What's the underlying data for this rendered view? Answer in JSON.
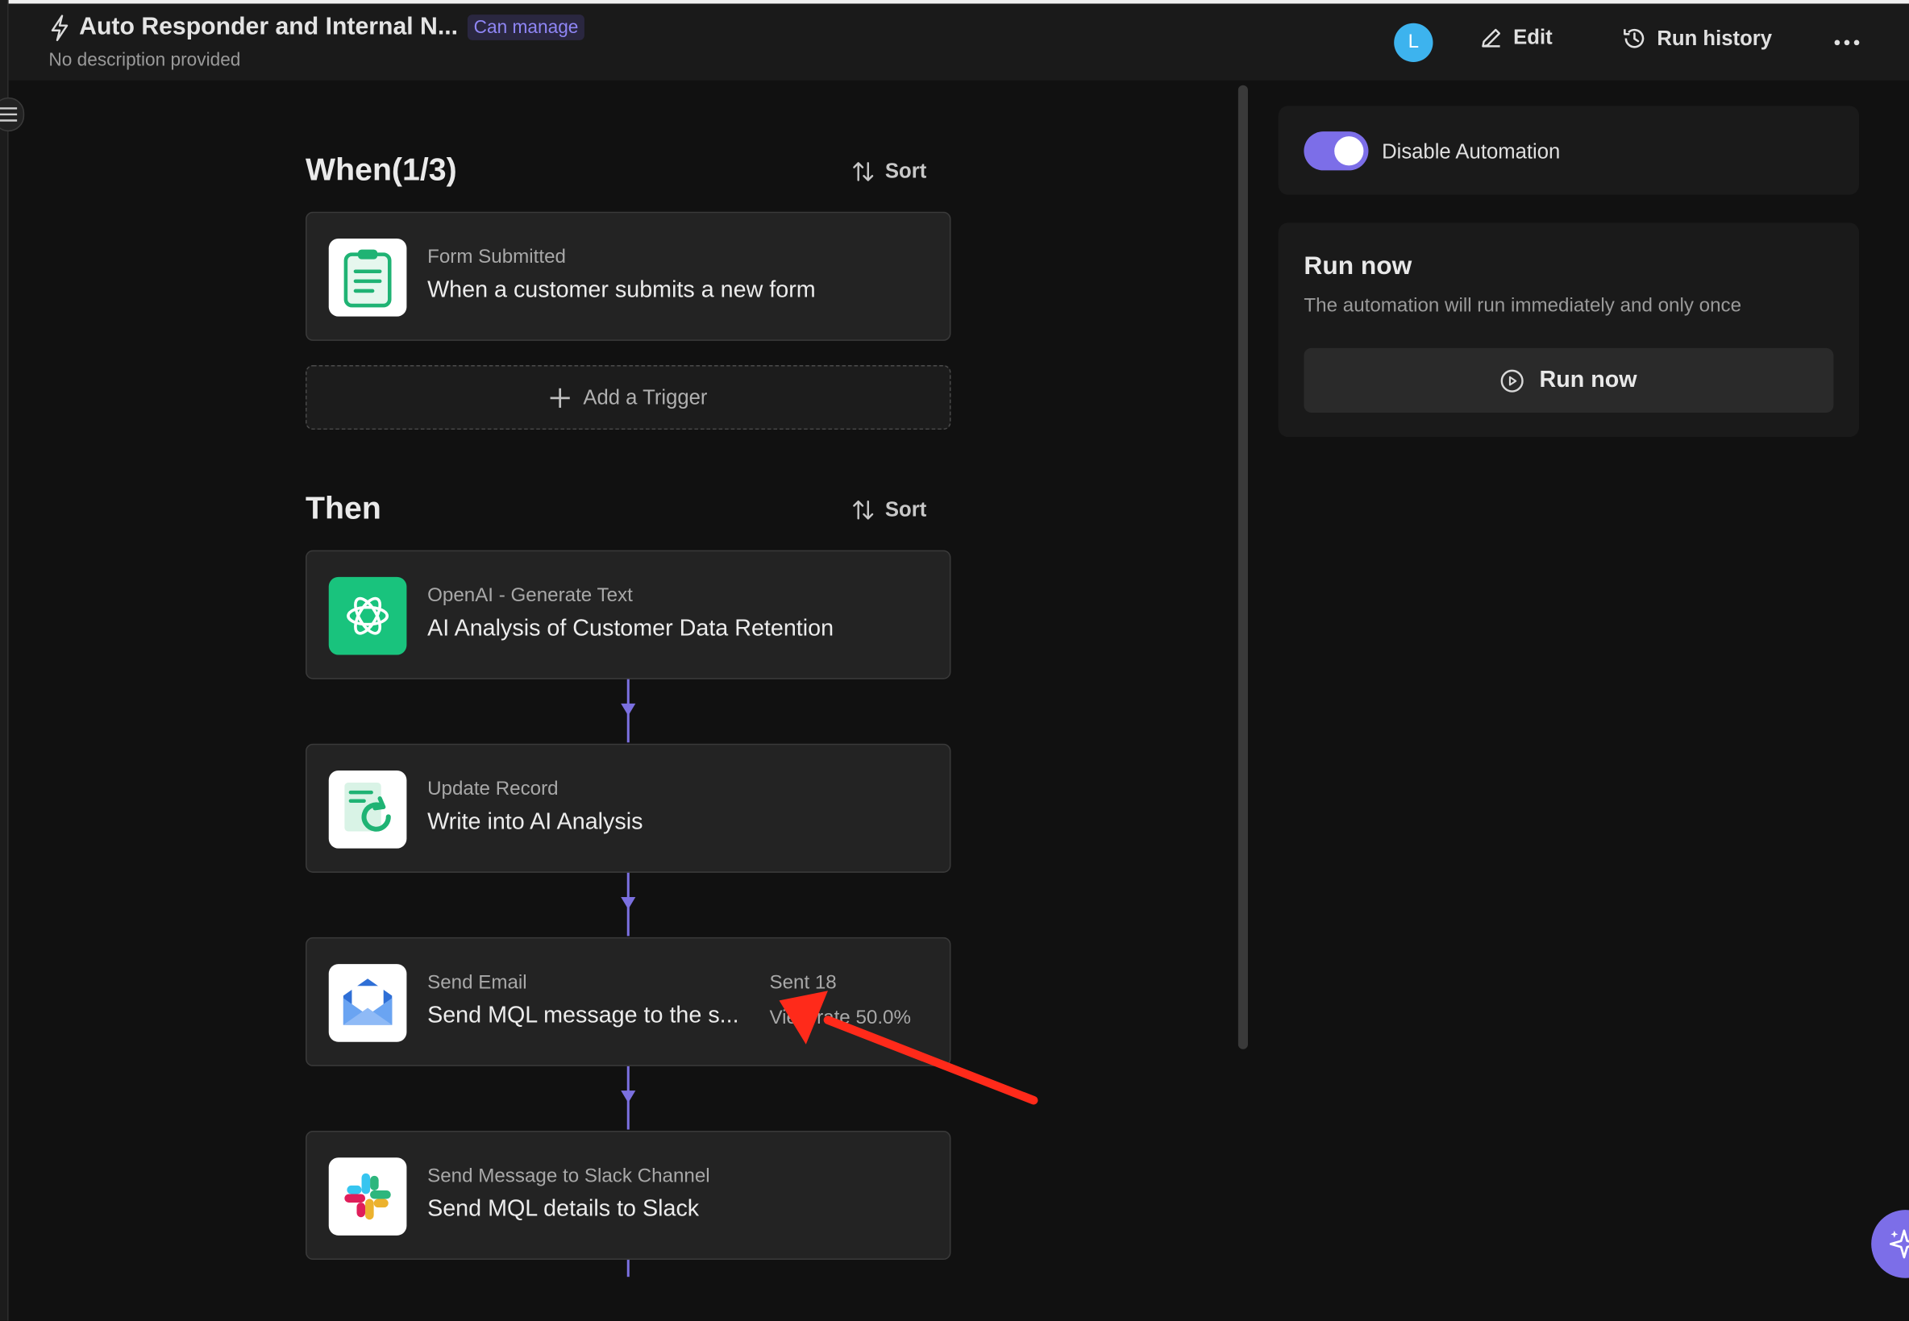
{
  "header": {
    "title": "Auto Responder and Internal N...",
    "badge": "Can manage",
    "subtitle": "No description provided",
    "avatar_letter": "L",
    "edit_label": "Edit",
    "run_history_label": "Run history",
    "more_icon": "more-horizontal-icon"
  },
  "when": {
    "title": "When(1/3)",
    "sort_label": "Sort",
    "triggers": [
      {
        "icon": "clipboard-form-icon",
        "type": "Form Submitted",
        "description": "When a customer submits a new form"
      }
    ],
    "add_label": "Add a Trigger"
  },
  "then": {
    "title": "Then",
    "sort_label": "Sort",
    "actions": [
      {
        "icon": "openai-icon",
        "type": "OpenAI - Generate Text",
        "description": "AI Analysis of Customer Data Retention"
      },
      {
        "icon": "update-record-icon",
        "type": "Update Record",
        "description": "Write into AI Analysis"
      },
      {
        "icon": "email-icon",
        "type": "Send Email",
        "description": "Send MQL message to the s...",
        "stat_sent": "Sent 18",
        "stat_view_rate": "View rate 50.0%"
      },
      {
        "icon": "slack-icon",
        "type": "Send Message to Slack Channel",
        "description": "Send MQL details to Slack"
      }
    ]
  },
  "side_panel": {
    "toggle_label": "Disable Automation",
    "toggle_on": true,
    "run_now_title": "Run now",
    "run_now_description": "The automation will run immediately and only once",
    "run_now_button": "Run now"
  },
  "colors": {
    "accent": "#7c6ee8",
    "annotation_arrow": "#ff2a1a",
    "background": "#111111",
    "card": "#232323"
  }
}
